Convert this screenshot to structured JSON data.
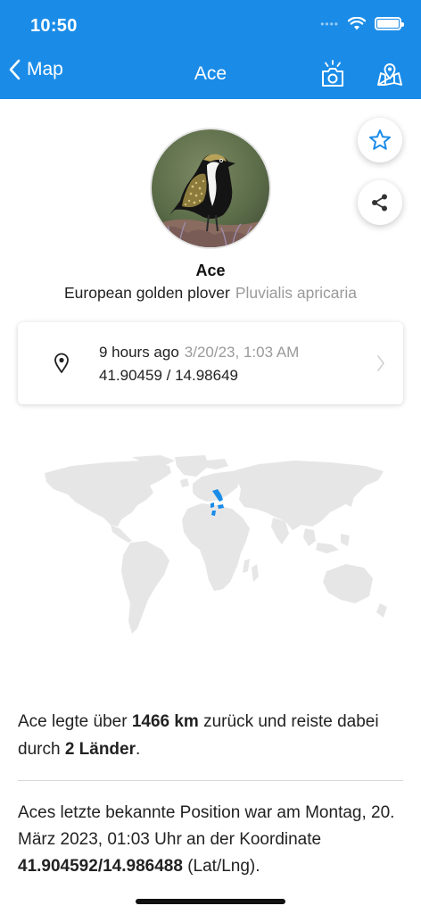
{
  "status_bar": {
    "time": "10:50",
    "battery_level": 1.0
  },
  "nav": {
    "back_label": "Map",
    "title": "Ace",
    "actions": [
      {
        "icon": "camera-flash-icon"
      },
      {
        "icon": "map-pin-icon"
      }
    ]
  },
  "floating_actions": [
    {
      "icon": "star-outline-icon"
    },
    {
      "icon": "share-icon"
    }
  ],
  "bird": {
    "name": "Ace",
    "common_name": "European golden plover",
    "latin_name": "Pluvialis apricaria"
  },
  "location": {
    "relative": "9 hours ago",
    "date": "3/20/23, 1:03 AM",
    "coordinates": "41.90459 / 14.98649"
  },
  "summary": {
    "prefix": "Ace legte über ",
    "distance": "1466 km",
    "middle": " zurück und reiste dabei durch ",
    "countries": "2 Länder",
    "suffix": "."
  },
  "last_position": {
    "text": "Aces letzte bekannte Position war am Montag, 20. März 2023, 01:03 Uhr an der Koordinate ",
    "coordinate": "41.904592/14.986488",
    "suffix": " (Lat/Lng)."
  },
  "colors": {
    "accent": "#1a8ce8",
    "map_land": "#e6e6e6",
    "highlight_country": "#1a8ce8"
  }
}
